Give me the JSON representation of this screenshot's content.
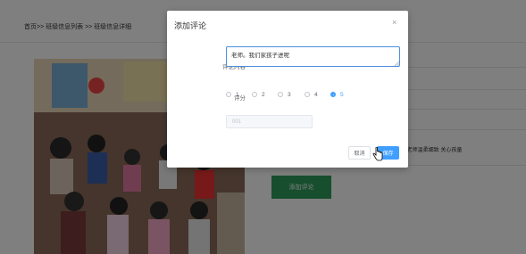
{
  "breadcrumb": "首页>> 班级信息列表 >> 班级信息详细",
  "background": {
    "info_text": "上 老师温柔细致 关心孩童",
    "add_comment_button": "添加评论"
  },
  "modal": {
    "title": "添加评论",
    "close_icon": "×",
    "content_label": "评论内容",
    "content_value": "老师。我们家孩子进呢",
    "score_label": "评分",
    "score_options": [
      "1",
      "2",
      "3",
      "4",
      "5"
    ],
    "score_selected": "5",
    "author_label": "评论人",
    "author_value": "001",
    "cancel_label": "取消",
    "save_label": "保存"
  },
  "colors": {
    "primary": "#409eff",
    "green_button": "#2e9c5a",
    "overlay": "rgba(0,0,0,0.5)"
  }
}
